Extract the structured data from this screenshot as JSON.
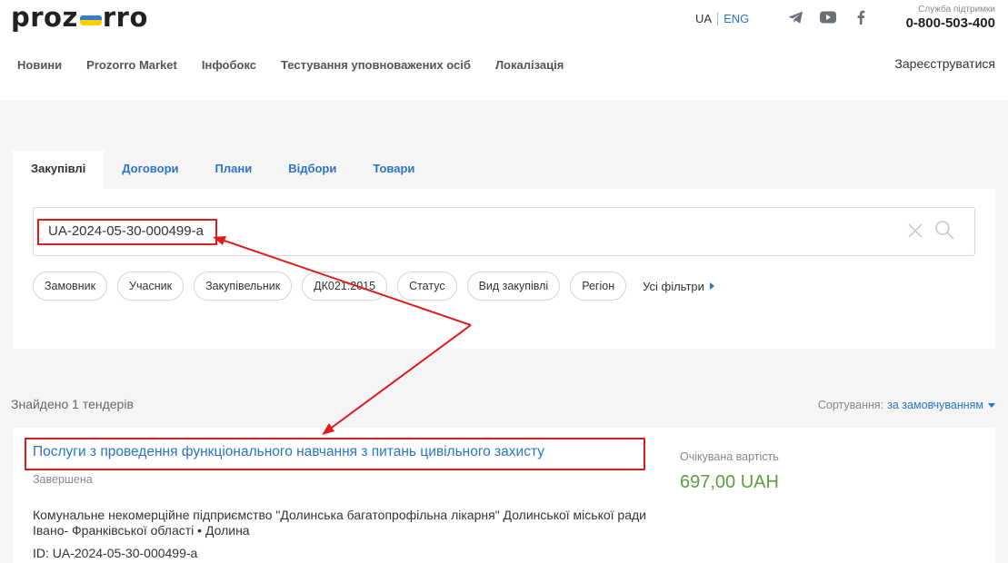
{
  "header": {
    "logo_text": "prozorro",
    "lang_ua": "UA",
    "lang_eng": "ENG",
    "support_caption": "Служба підтримки",
    "support_phone": "0-800-503-400",
    "social_icons": [
      "telegram-icon",
      "youtube-icon",
      "facebook-icon"
    ]
  },
  "nav": {
    "items": [
      "Новини",
      "Prozorro Market",
      "Інфобокс",
      "Тестування уповноважених осіб",
      "Локалізація"
    ],
    "register_label": "Зареєструватися"
  },
  "search": {
    "tabs": [
      "Закупівлі",
      "Договори",
      "Плани",
      "Відбори",
      "Товари"
    ],
    "active_tab": "Закупівлі",
    "query_value": "UA-2024-05-30-000499-a",
    "filters": [
      "Замовник",
      "Учасник",
      "Закупівельник",
      "ДК021:2015",
      "Статус",
      "Вид закупівлі",
      "Регіон"
    ],
    "all_filters_label": "Усі фільтри"
  },
  "results": {
    "found_text": "Знайдено 1 тендерів",
    "sort_label": "Сортування:",
    "sort_value": "за замовчуванням",
    "items": [
      {
        "title": "Послуги з проведення функціонального навчання з питань цивільного захисту",
        "status": "Завершена",
        "organization": "Комунальне некомерційне підприємство \"Долинська багатопрофільна лікарня\" Долинської міської ради Івано- Франківської області • Долина",
        "id_text": "ID: UA-2024-05-30-000499-a",
        "price_caption": "Очікувана вартість",
        "price": "697,00 UAH"
      }
    ]
  },
  "colors": {
    "accent_blue": "#2a74c7",
    "price_green": "#5a9f3e",
    "annotation_red": "#e01b1b",
    "flag_blue": "#2f7fd7",
    "flag_yellow": "#ffcf00"
  }
}
